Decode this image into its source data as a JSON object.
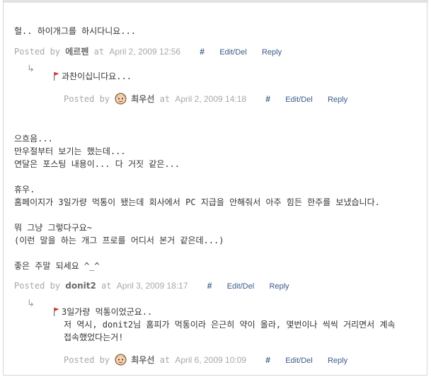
{
  "comments": [
    {
      "lines": [
        "헐.. 하이개그를 하시다니요..."
      ],
      "posted_by": "Posted by",
      "author": "에르펜",
      "at": "at",
      "date": "April 2, 2009 12:56",
      "hash": "#",
      "edit": "Edit/Del",
      "reply": "Reply",
      "replies": [
        {
          "lines": [
            "과찬이십니다요..."
          ],
          "posted_by": "Posted by",
          "author": "최우선",
          "at": "at",
          "date": "April 2, 2009 14:18",
          "hash": "#",
          "edit": "Edit/Del",
          "reply": "Reply"
        }
      ]
    },
    {
      "lines": [
        "으흐음...",
        "만우절부터 보기는 했는데...",
        "연달은 포스팅 내용이... 다 거짓 같은...",
        "",
        "휴우.",
        "홈페이지가 3일가량 먹통이 됐는데 회사에서 PC 지급을 안해줘서 아주 힘든 한주를 보냈습니다.",
        "",
        "뭐 그냥 그렇다구요~",
        "(이런 말을 하는 개그 프로를 어디서 본거 같은데...)",
        "",
        "좋은 주말 되세요 ^_^"
      ],
      "posted_by": "Posted by",
      "author": "donit2",
      "at": "at",
      "date": "April 3, 2009 18:17",
      "hash": "#",
      "edit": "Edit/Del",
      "reply": "Reply",
      "replies": [
        {
          "lines": [
            "3일가량 먹통이었군요..",
            "저 역시, donit2님 홈피가 먹통이라 은근히 약이 올라, 몇번이나 씩씩 거리면서 계속",
            "접속했었다는거!"
          ],
          "posted_by": "Posted by",
          "author": "최우선",
          "at": "at",
          "date": "April 6, 2009 10:09",
          "hash": "#",
          "edit": "Edit/Del",
          "reply": "Reply"
        }
      ]
    }
  ],
  "icons": {
    "reply_arrow": "↳",
    "flag": "flag-icon",
    "avatar": "avatar-icon"
  }
}
